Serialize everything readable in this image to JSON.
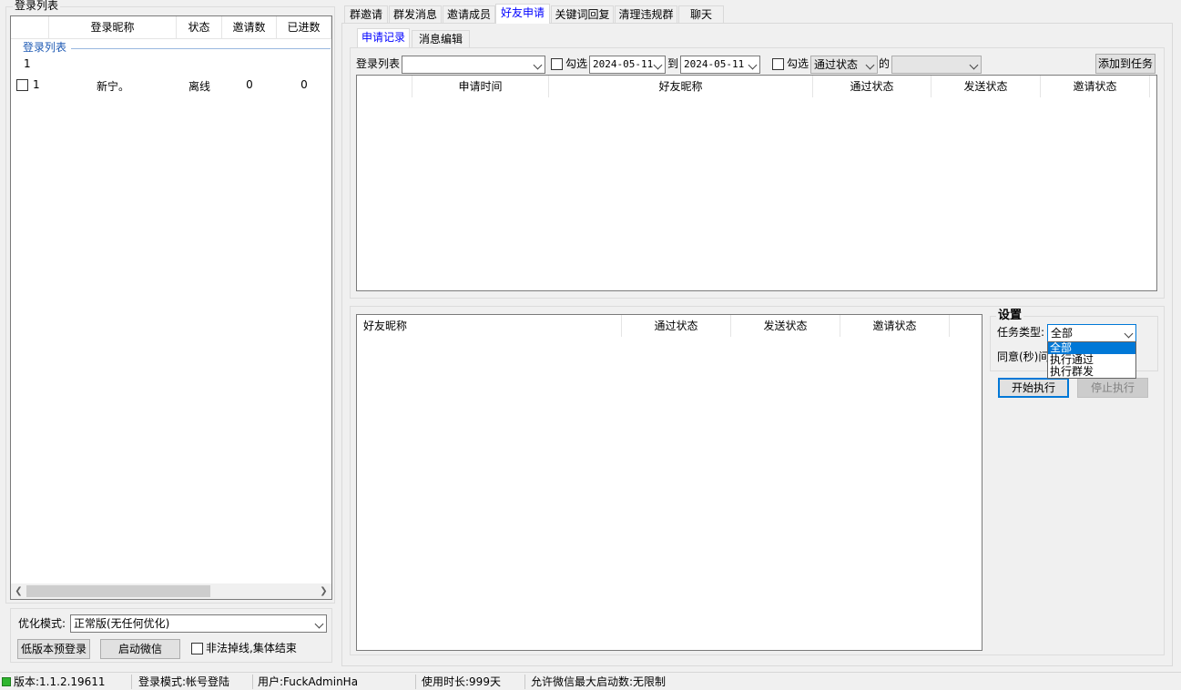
{
  "left": {
    "group_title": "登录列表",
    "columns": [
      "登录昵称",
      "状态",
      "邀请数",
      "已进数"
    ],
    "tree_group_label": "登录列表",
    "tree_group_count": "1",
    "rows": [
      {
        "index": "1",
        "nickname": "新宁。",
        "status": "离线",
        "invited": "0",
        "joined": "0"
      }
    ],
    "optimize_label": "优化模式:",
    "optimize_value": "正常版(无任何优化)",
    "low_version_login": "低版本预登录",
    "start_wechat": "启动微信",
    "illegal_offline_label": "非法掉线,集体结束"
  },
  "tabs": [
    "群邀请",
    "群发消息",
    "邀请成员",
    "好友申请",
    "关键词回复",
    "清理违规群",
    "聊天"
  ],
  "active_tab": "好友申请",
  "subtabs": [
    "申请记录",
    "消息编辑"
  ],
  "filter": {
    "login_list_label": "登录列表",
    "login_list_value": "",
    "check_label_1": "勾选",
    "date_from": "2024-05-11",
    "to_label": "到",
    "date_to": "2024-05-11",
    "check_label_2": "勾选",
    "pass_status_value": "通过状态",
    "of_label": "的",
    "status_value": "",
    "add_task": "添加到任务"
  },
  "record_table": {
    "columns": [
      "申请时间",
      "好友昵称",
      "通过状态",
      "发送状态",
      "邀请状态"
    ]
  },
  "task_table": {
    "columns": [
      "好友昵称",
      "通过状态",
      "发送状态",
      "邀请状态"
    ]
  },
  "settings": {
    "title": "设置",
    "task_type_label": "任务类型:",
    "task_type_value": "全部",
    "task_type_options": [
      "全部",
      "执行通过",
      "执行群发"
    ],
    "agree_interval_label": "同意(秒)间",
    "start_button": "开始执行",
    "stop_button": "停止执行"
  },
  "statusbar": {
    "version": "版本:1.1.2.19611",
    "login_mode": "登录模式:帐号登陆",
    "user": "用户:FuckAdminHa",
    "usage": "使用时长:999天",
    "max_wechat": "允许微信最大启动数:无限制"
  },
  "colors": {
    "accent": "#0078d7",
    "tab_active_text": "#0000ff",
    "status_led": "#2fb52f"
  }
}
